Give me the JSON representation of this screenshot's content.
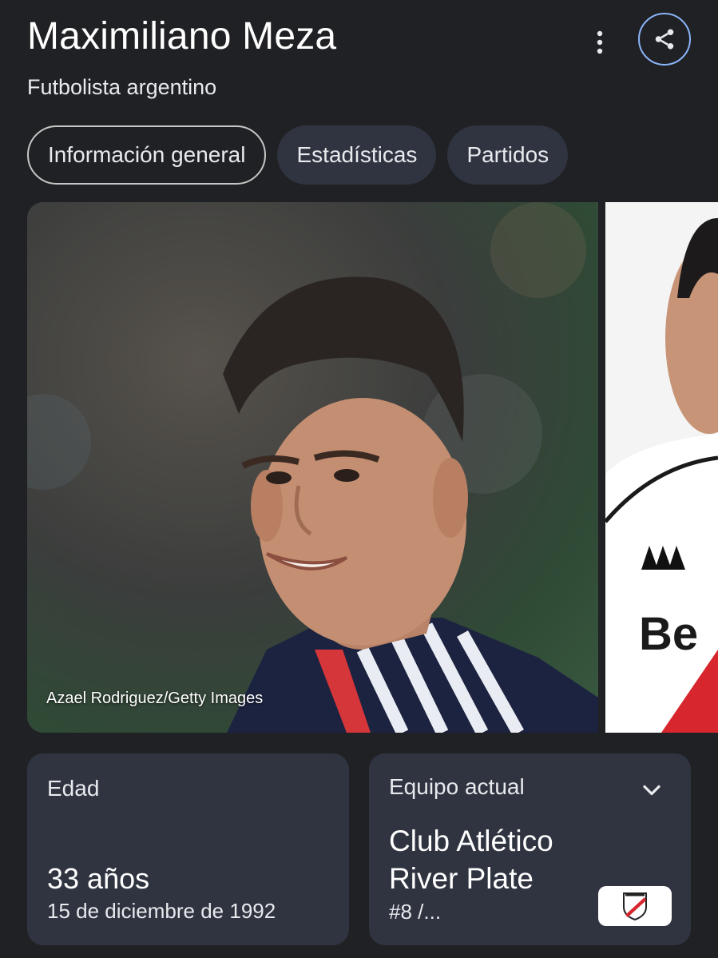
{
  "header": {
    "title": "Maximiliano Meza",
    "subtitle": "Futbolista argentino",
    "more_icon": "more-vert-icon",
    "share_icon": "share-icon",
    "accent_color": "#8ab4f8"
  },
  "tabs": [
    {
      "label": "Información general",
      "active": true
    },
    {
      "label": "Estadísticas",
      "active": false
    },
    {
      "label": "Partidos",
      "active": false
    }
  ],
  "photos": {
    "main_caption": "Azael Rodriguez/Getty Images"
  },
  "age_card": {
    "label": "Edad",
    "value": "33 años",
    "birth_date": "15 de diciembre de 1992"
  },
  "team_card": {
    "label": "Equipo actual",
    "team_name": "Club Atlético River Plate",
    "number": "#8 /...",
    "expand_icon": "chevron-down-icon",
    "badge_icon": "club-crest-icon"
  }
}
